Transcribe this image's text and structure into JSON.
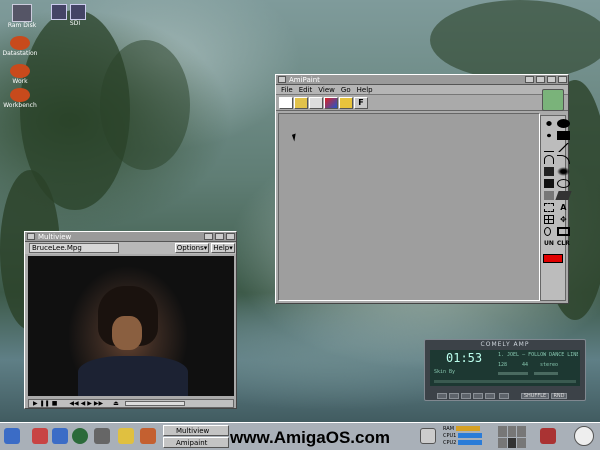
{
  "desktop": {
    "icons": [
      {
        "label": "Ram Disk"
      },
      {
        "label": "Datastation"
      },
      {
        "label": "Work"
      },
      {
        "label": "Workbench"
      },
      {
        "label": "SDI"
      }
    ]
  },
  "amipaint": {
    "title": "AmiPaint",
    "menu": [
      "File",
      "Edit",
      "View",
      "Go",
      "Help"
    ],
    "toolbar_icons": [
      "new-icon",
      "open-icon",
      "save-icon",
      "palette-icon",
      "folder-icon",
      "font-icon"
    ],
    "palette_color": "#e00000"
  },
  "multiview": {
    "title": "Multiview",
    "file": "BruceLee.Mpg",
    "options_label": "Options▾",
    "help_label": "Help▾"
  },
  "amp": {
    "title": "COMELY AMP",
    "time": "01:53",
    "track": "1. JOEL – FOLLOW DANCE LINE",
    "skin": "Skin By",
    "kbps": "128",
    "khz": "44",
    "mode": "stereo",
    "shuffle": "SHUFFLE",
    "rnd": "RND"
  },
  "taskbar": {
    "tasks": [
      "Multiview",
      "Amipaint"
    ],
    "banner": "www.AmigaOS.com",
    "meters": [
      "RAM",
      "CPU1",
      "CPU2"
    ]
  },
  "colors": {
    "title_bg": "#9a9a9a",
    "window_bg": "#aaaaaa",
    "canvas_bg": "#9e9e9e",
    "taskbar_bg": "#a9b0b8"
  }
}
